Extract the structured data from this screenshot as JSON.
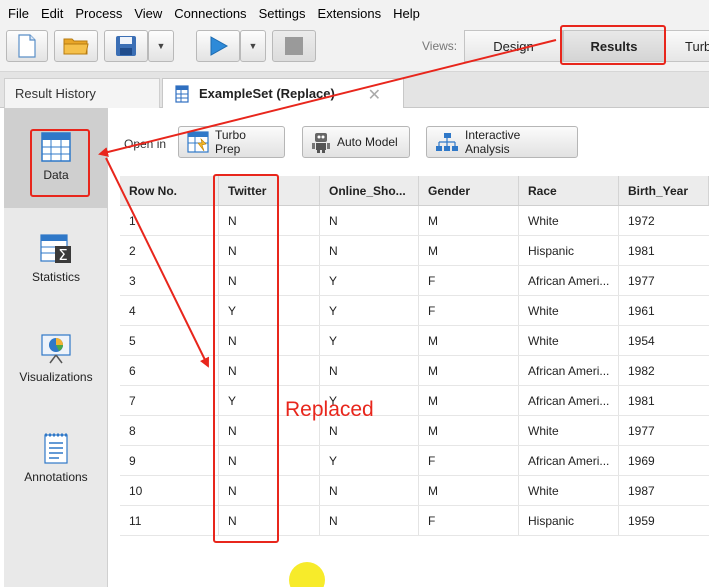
{
  "menu": [
    "File",
    "Edit",
    "Process",
    "View",
    "Connections",
    "Settings",
    "Extensions",
    "Help"
  ],
  "toolbar": {
    "icons": [
      "new-process-icon",
      "open-folder-icon",
      "save-icon",
      "dropdown-icon",
      "run-icon",
      "dropdown-icon",
      "stop-icon"
    ],
    "views_label": "Views:",
    "views": [
      "Design",
      "Results",
      "Turbo Prep"
    ],
    "active_view": "Results",
    "accent_run": "#2e8ad8"
  },
  "tabs": {
    "history": "Result History",
    "active": "ExampleSet (Replace)"
  },
  "nav": [
    {
      "label": "Data",
      "icon": "data-table-icon"
    },
    {
      "label": "Statistics",
      "icon": "statistics-icon"
    },
    {
      "label": "Visualizations",
      "icon": "visualizations-icon"
    },
    {
      "label": "Annotations",
      "icon": "annotations-icon"
    }
  ],
  "open_in": {
    "label": "Open in",
    "buttons": [
      "Turbo Prep",
      "Auto Model",
      "Interactive Analysis"
    ]
  },
  "table": {
    "columns": [
      "Row No.",
      "Twitter",
      "Online_Sho...",
      "Gender",
      "Race",
      "Birth_Year"
    ],
    "rows": [
      [
        "1",
        "N",
        "N",
        "M",
        "White",
        "1972"
      ],
      [
        "2",
        "N",
        "N",
        "M",
        "Hispanic",
        "1981"
      ],
      [
        "3",
        "N",
        "Y",
        "F",
        "African Ameri...",
        "1977"
      ],
      [
        "4",
        "Y",
        "Y",
        "F",
        "White",
        "1961"
      ],
      [
        "5",
        "N",
        "Y",
        "M",
        "White",
        "1954"
      ],
      [
        "6",
        "N",
        "N",
        "M",
        "African Ameri...",
        "1982"
      ],
      [
        "7",
        "Y",
        "Y",
        "M",
        "African Ameri...",
        "1981"
      ],
      [
        "8",
        "N",
        "N",
        "M",
        "White",
        "1977"
      ],
      [
        "9",
        "N",
        "Y",
        "F",
        "African Ameri...",
        "1969"
      ],
      [
        "10",
        "N",
        "N",
        "M",
        "White",
        "1987"
      ],
      [
        "11",
        "N",
        "N",
        "F",
        "Hispanic",
        "1959"
      ]
    ]
  },
  "annotation": {
    "text": "Replaced",
    "color": "#e8261c"
  }
}
